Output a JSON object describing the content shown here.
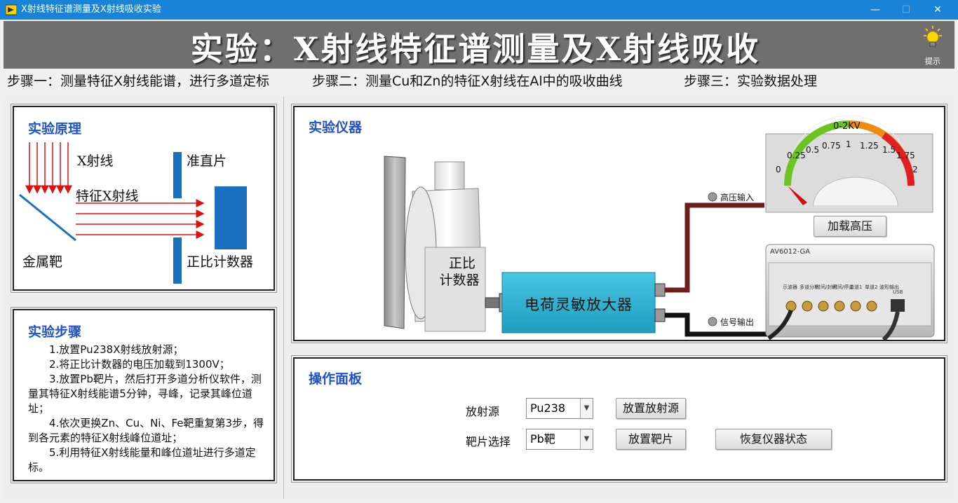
{
  "window": {
    "title": "X射线特征谱测量及X射线吸收实验",
    "minimize": "—",
    "maximize": "☐",
    "close": "✕"
  },
  "banner": {
    "title": "实验：X射线特征谱测量及X射线吸收",
    "hint_label": "提示"
  },
  "steps": {
    "step1": "步骤一：测量特征X射线能谱，进行多道定标",
    "step2": "步骤二：测量Cu和Zn的特征X射线在Al中的吸收曲线",
    "step3": "步骤三：实验数据处理"
  },
  "principle": {
    "heading": "实验原理",
    "xray": "X射线",
    "collimator": "准直片",
    "characteristic": "特征X射线",
    "target": "金属靶",
    "counter": "正比计数器"
  },
  "procedure": {
    "heading": "实验步骤",
    "items": [
      "1.放置Pu238X射线放射源；",
      "2.将正比计数器的电压加载到1300V；",
      "3.放置Pb靶片，然后打开多道分析仪软件，测量其特征X射线能谱5分钟，寻峰，记录其峰位道址；",
      "4.依次更换Zn、Cu、Ni、Fe靶重复第3步，得到各元素的特征X射线峰位道址；",
      "5.利用特征X射线能量和峰位道址进行多道定标。"
    ]
  },
  "instrument": {
    "heading": "实验仪器",
    "counter_label_line1": "正比",
    "counter_label_line2": "计数器",
    "amplifier_label": "电荷灵敏放大器",
    "hv_input_label": "高压输入",
    "signal_output_label": "信号输出",
    "load_hv_button": "加载高压",
    "device_model": "AV6012-GA",
    "port_labels": [
      "示波器",
      "多道分析",
      "时间/封闭",
      "时间/停止",
      "单道1",
      "单道2",
      "波形输出",
      "USB"
    ],
    "meter": {
      "title": "0-2KV",
      "ticks": [
        "0",
        "0.25",
        "0.5",
        "0.75",
        "1",
        "1.25",
        "1.5",
        "1.75",
        "2"
      ],
      "value": 0,
      "min": 0,
      "max": 2
    }
  },
  "operation": {
    "heading": "操作面板",
    "source_label": "放射源",
    "source_value": "Pu238",
    "place_source_button": "放置放射源",
    "target_label": "靶片选择",
    "target_value": "Pb靶",
    "place_target_button": "放置靶片",
    "reset_button": "恢复仪器状态"
  },
  "colors": {
    "titlebar": "#1883d7",
    "heading_blue": "#1f52c6",
    "amplifier": "#2fb5d6",
    "xray_red": "#e01010",
    "collimator_blue": "#1a6fc0"
  }
}
